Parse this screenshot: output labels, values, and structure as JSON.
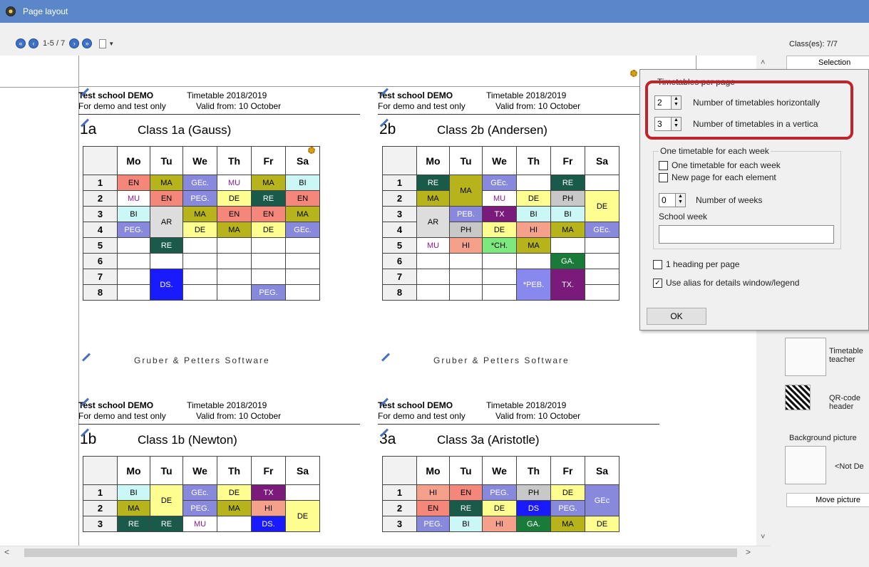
{
  "window": {
    "title": "Page layout"
  },
  "toolbar": {
    "page_indicator": "1-5 / 7"
  },
  "timetables": [
    {
      "school": "Test school  DEMO",
      "sub": "For demo and test only",
      "year": "Timetable 2018/2019",
      "valid": "Valid from: 10 October",
      "code": "1a",
      "name": "Class 1a (Gauss)",
      "footer": "Gruber & Petters Software"
    },
    {
      "school": "Test school  DEMO",
      "sub": "For demo and test only",
      "year": "Timetable 2018/2019",
      "valid": "Valid from: 10 October",
      "code": "2b",
      "name": "Class 2b (Andersen)",
      "footer": "Gruber & Petters Software"
    },
    {
      "school": "Test school  DEMO",
      "sub": "For demo and test only",
      "year": "Timetable 2018/2019",
      "valid": "Valid from: 10 October",
      "code": "1b",
      "name": "Class 1b (Newton)"
    },
    {
      "school": "Test school  DEMO",
      "sub": "For demo and test only",
      "year": "Timetable 2018/2019",
      "valid": "Valid from: 10 October",
      "code": "3a",
      "name": "Class 3a (Aristotle)"
    }
  ],
  "days": [
    "Mo",
    "Tu",
    "We",
    "Th",
    "Fr",
    "Sa"
  ],
  "periods": [
    "1",
    "2",
    "3",
    "4",
    "5",
    "6",
    "7",
    "8"
  ],
  "side_panel": {
    "classes": "Class(es): 7/7",
    "selection": "Selection",
    "timetable_teacher": "Timetable teacher",
    "qr_code": "QR-code header",
    "background_picture": "Background picture",
    "not_defined": "<Not De",
    "move_picture": "Move picture"
  },
  "popup": {
    "title": "Timetables per page",
    "horizontal_value": "2",
    "horizontal_label": "Number of timetables horizontally",
    "vertical_value": "3",
    "vertical_label": "Number of timetables in a vertica",
    "week_group": "One timetable for each week",
    "one_per_week": "One timetable for each week",
    "new_page": "New page for each element",
    "weeks_value": "0",
    "weeks_label": "Number of weeks",
    "school_week": "School week",
    "one_heading": "1 heading per page",
    "use_alias": "Use alias for details window/legend",
    "ok": "OK"
  },
  "colors": {
    "accent": "#5b87c9",
    "highlight": "#c0232b"
  }
}
